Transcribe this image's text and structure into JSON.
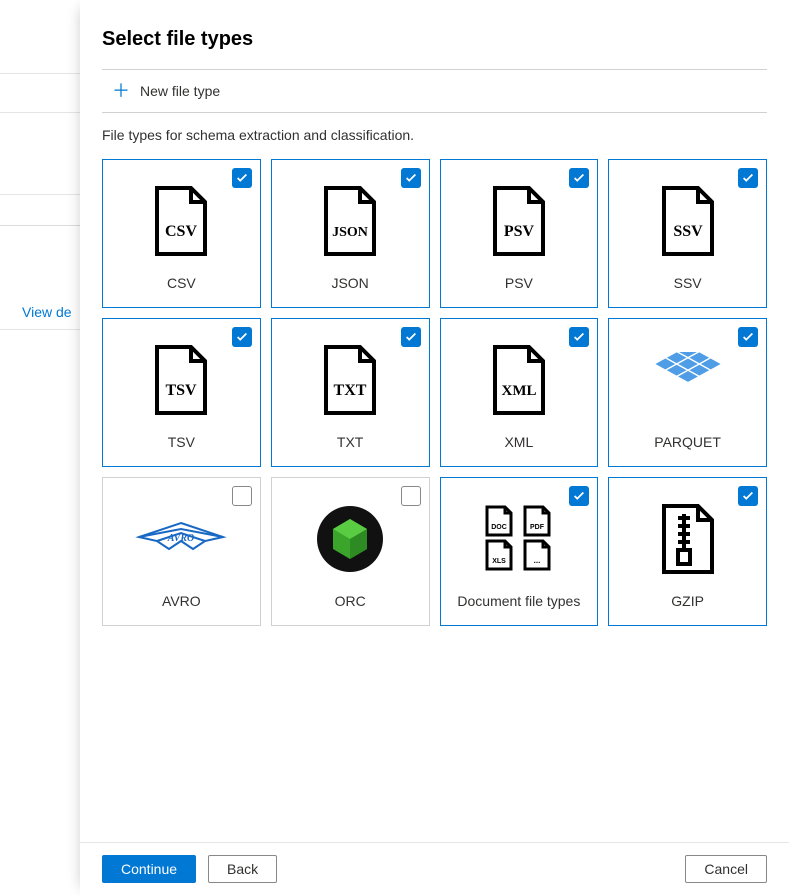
{
  "bg": {
    "view_details": "View de"
  },
  "title": "Select file types",
  "new_file_type": "New file type",
  "subtitle": "File types for schema extraction and classification.",
  "cards": [
    {
      "label": "CSV"
    },
    {
      "label": "JSON"
    },
    {
      "label": "PSV"
    },
    {
      "label": "SSV"
    },
    {
      "label": "TSV"
    },
    {
      "label": "TXT"
    },
    {
      "label": "XML"
    },
    {
      "label": "PARQUET"
    },
    {
      "label": "AVRO"
    },
    {
      "label": "ORC"
    },
    {
      "label": "Document file types"
    },
    {
      "label": "GZIP"
    }
  ],
  "buttons": {
    "continue": "Continue",
    "back": "Back",
    "cancel": "Cancel"
  }
}
